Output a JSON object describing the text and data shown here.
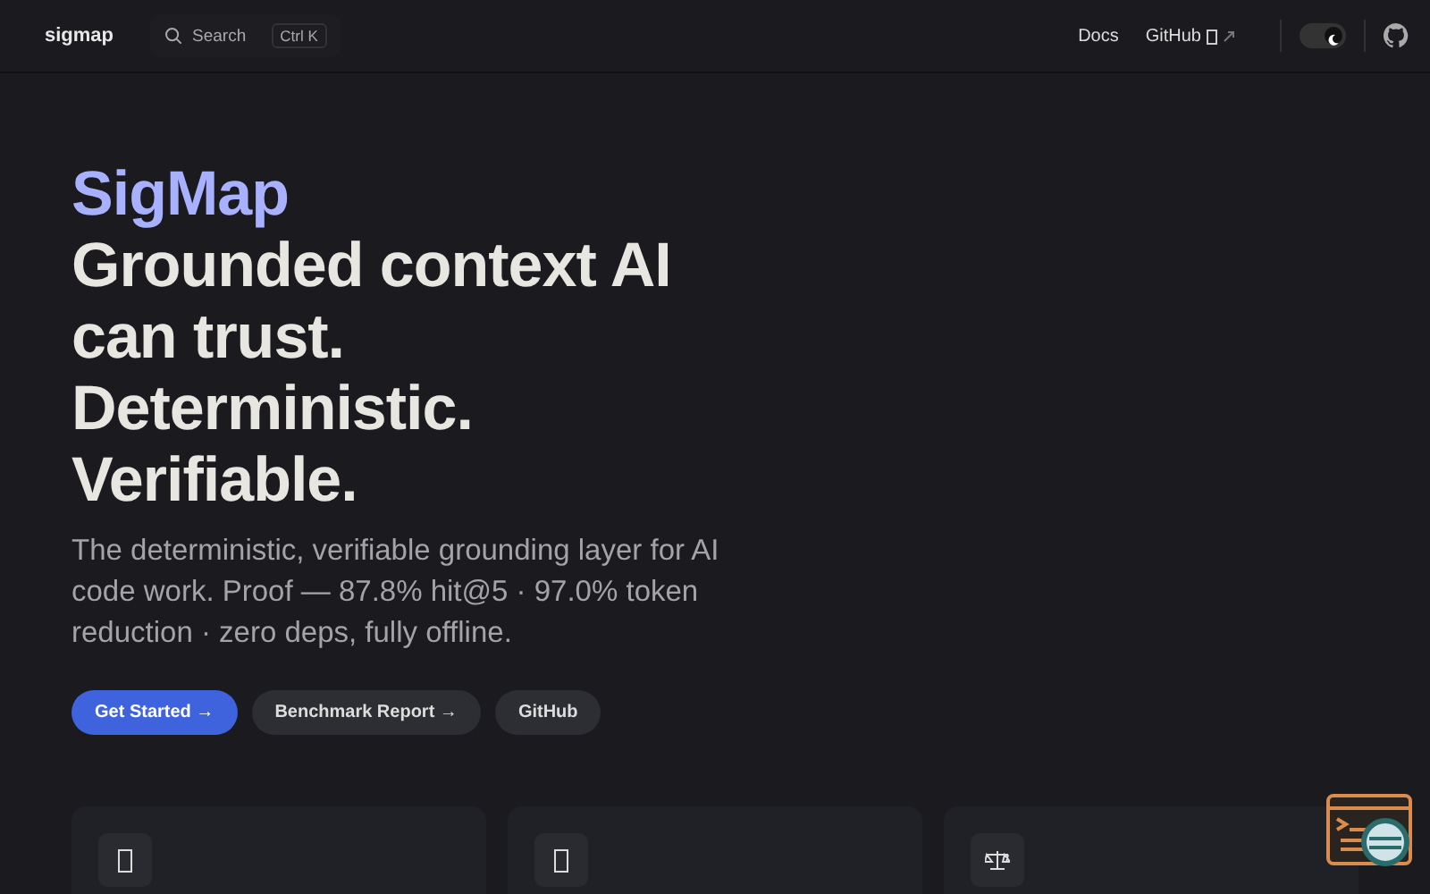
{
  "nav": {
    "logo": "sigmap",
    "search": {
      "placeholder": "Search",
      "shortcut": "Ctrl K"
    },
    "links": [
      {
        "label": "Docs",
        "external": false
      },
      {
        "label": "GitHub",
        "external": true
      }
    ],
    "dark_mode": true
  },
  "hero": {
    "name": "SigMap",
    "tagline": "Grounded context AI can trust. Deterministic. Verifiable.",
    "text": "The deterministic, verifiable grounding layer for AI code work. Proof — 87.8% hit@5 · 97.0% token reduction · zero deps, fully offline.",
    "buttons": [
      {
        "label": "Get Started →",
        "kind": "primary"
      },
      {
        "label": "Benchmark Report →",
        "kind": "secondary"
      },
      {
        "label": "GitHub",
        "kind": "secondary"
      }
    ]
  },
  "cards": [
    {
      "kind": "box"
    },
    {
      "kind": "box"
    },
    {
      "kind": "scale"
    }
  ]
}
